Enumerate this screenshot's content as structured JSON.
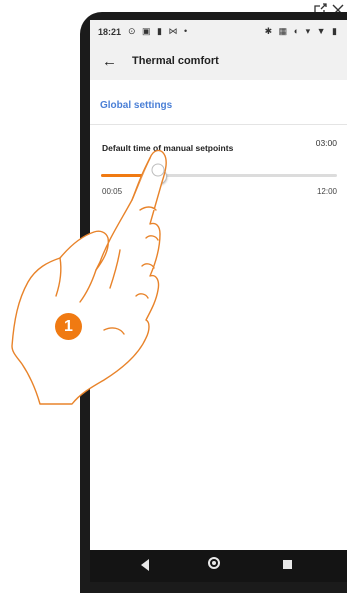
{
  "window": {
    "external_icon": "external-link-icon",
    "close_icon": "close-icon"
  },
  "statusbar": {
    "time": "18:21",
    "left_icons": "⊙ ▣ ▮ ⋈ •",
    "right_icons": "✱ ▦ ◐ ▾ ▼ ▮"
  },
  "appbar": {
    "back_icon": "←",
    "title": "Thermal comfort"
  },
  "section": {
    "title": "Global settings"
  },
  "setting": {
    "label": "Default time of manual setpoints",
    "value": "03:00",
    "slider_min": "00:05",
    "slider_max": "12:00",
    "slider_fraction": 0.24
  },
  "instruction": {
    "step_number": "1"
  },
  "colors": {
    "accent": "#f07a12",
    "link": "#4a7fd6"
  }
}
